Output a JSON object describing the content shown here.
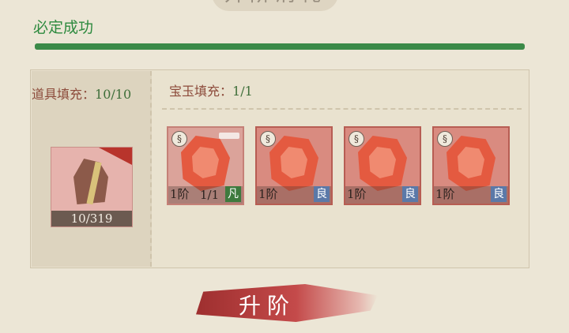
{
  "header": {
    "title": "升阶消耗"
  },
  "success": {
    "label": "必定成功",
    "progress": 1.0
  },
  "item_fill": {
    "label": "道具填充：",
    "value": "10/10"
  },
  "gem_fill": {
    "label": "宝玉填充：",
    "value": "1/1"
  },
  "item_slot": {
    "count": "10/319"
  },
  "gems": [
    {
      "tier": "1阶",
      "qty": "1/1",
      "grade": "凡",
      "selected": true
    },
    {
      "tier": "1阶",
      "qty": "",
      "grade": "良",
      "selected": false
    },
    {
      "tier": "1阶",
      "qty": "",
      "grade": "良",
      "selected": false
    },
    {
      "tier": "1阶",
      "qty": "",
      "grade": "良",
      "selected": false
    }
  ],
  "swirl_glyph": "§",
  "upgrade_button": {
    "label": "升阶"
  },
  "colors": {
    "background": "#ece6d6",
    "success_green": "#3b8a48",
    "button_red": "#9e2f2f",
    "grade_common": "#3e7a3e",
    "grade_good": "#5b79a8"
  }
}
